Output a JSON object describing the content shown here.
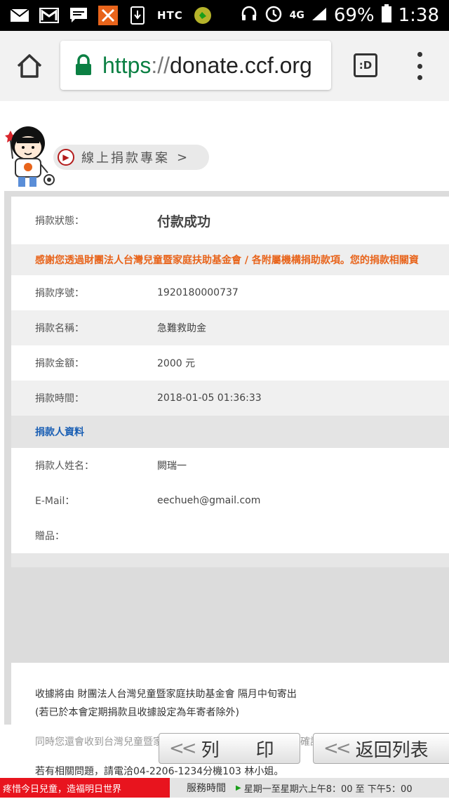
{
  "status_bar": {
    "carrier_text": "HTC",
    "signal_text": "4G",
    "battery": "69%",
    "time": "1:38",
    "icons": [
      "mail-icon",
      "gmail-icon",
      "message-icon",
      "app-icon",
      "download-icon",
      "htc-icon",
      "app-badge-icon",
      "headset-icon",
      "alarm-icon",
      "signal-icon",
      "battery-icon"
    ]
  },
  "browser": {
    "url_scheme": "https",
    "url_sep": "://",
    "url_host": "donate.ccf.org",
    "tabs_label": ":D",
    "icons": [
      "home-icon",
      "lock-icon",
      "tabs-icon",
      "menu-icon"
    ]
  },
  "page": {
    "project_link": "線上捐款專案",
    "project_arrow": ">",
    "status_label": "捐款狀態：",
    "status_value": "付款成功",
    "notice": "感謝您透過財團法人台灣兒童暨家庭扶助基金會 / 各附屬機構捐助款項。您的捐款相關資",
    "details": [
      {
        "label": "捐款序號：",
        "value": "1920180000737"
      },
      {
        "label": "捐款名稱：",
        "value": "急難救助金"
      },
      {
        "label": "捐款金額：",
        "value": "2000 元"
      },
      {
        "label": "捐款時間：",
        "value": "2018-01-05 01:36:33"
      }
    ],
    "donor_section_title": "捐款人資料",
    "donor": [
      {
        "label": "捐款人姓名：",
        "value": "闕瑞一"
      },
      {
        "label": "E-Mail：",
        "value": "eechueh@gmail.com"
      },
      {
        "label": "贈品：",
        "value": ""
      }
    ],
    "notes": [
      "收據將由 財團法人台灣兒童暨家庭扶助基金會 隔月中旬寄出",
      "(若已於本會定期捐款且收據設定為年寄者除外)",
      "同時您還會收到台灣兒童暨家庭扶助基金會發送的捐款成功的確認郵件。",
      "若有相關問題，請電洽04-2206-1234分機103 林小姐。"
    ],
    "print_button": "列　　印",
    "back_button": "返回列表",
    "button_chevron": "<<"
  },
  "footer": {
    "slogan": "疼惜今日兒童，造福明日世界",
    "hours_label": "服務時間",
    "hours_value": "星期一至星期六上午8：00 至 下午5：00"
  },
  "colors": {
    "success": "#1a9e1a",
    "notice": "#e8641b",
    "section": "#1a5fb4",
    "footer_red": "#e8141e",
    "url_green": "#0b8043"
  }
}
